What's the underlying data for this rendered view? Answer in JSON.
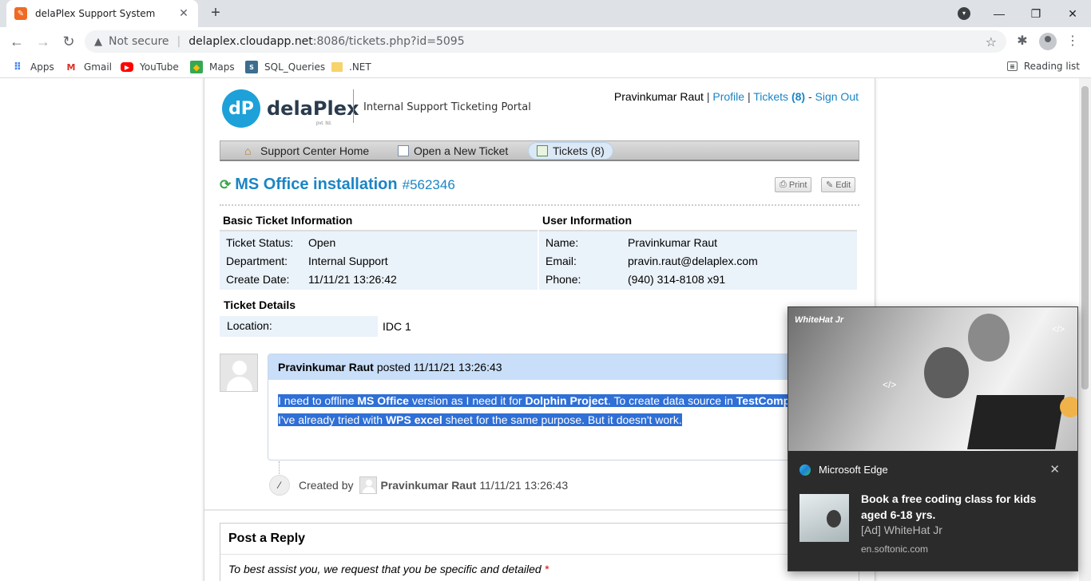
{
  "browser": {
    "tab_title": "delaPlex Support System",
    "tab_close": "✕",
    "new_tab": "+",
    "not_secure": "Not secure",
    "url_host": "delaplex.cloudapp.net",
    "url_rest": ":8086/tickets.php?id=5095",
    "bookmarks": [
      {
        "label": "Apps"
      },
      {
        "label": "Gmail"
      },
      {
        "label": "YouTube"
      },
      {
        "label": "Maps"
      },
      {
        "label": "SQL_Queries"
      },
      {
        "label": ".NET"
      }
    ],
    "reading_list": "Reading list"
  },
  "header": {
    "logo_text": "delaPlex",
    "logo_sub": "pvt. ltd.",
    "portal_title": "Internal Support Ticketing Portal",
    "user_name": "Pravinkumar Raut",
    "profile_link": "Profile",
    "tickets_link": "Tickets",
    "tickets_count": "(8)",
    "signout_link": "Sign Out"
  },
  "nav": {
    "home": "Support Center Home",
    "new_ticket": "Open a New Ticket",
    "tickets": "Tickets (8)"
  },
  "ticket": {
    "title": "MS Office installation",
    "number": "#562346",
    "print_label": "Print",
    "edit_label": "Edit",
    "basic_heading": "Basic Ticket Information",
    "basic_rows": [
      {
        "label": "Ticket Status:",
        "value": "Open"
      },
      {
        "label": "Department:",
        "value": "Internal Support"
      },
      {
        "label": "Create Date:",
        "value": "11/11/21 13:26:42"
      }
    ],
    "user_heading": "User Information",
    "user_rows": [
      {
        "label": "Name:",
        "value": "Pravinkumar Raut"
      },
      {
        "label": "Email:",
        "value": "pravin.raut@delaplex.com"
      },
      {
        "label": "Phone:",
        "value": "(940) 314-8108 x91"
      }
    ],
    "details_heading": "Ticket Details",
    "location_label": "Location:",
    "location_value": "IDC 1"
  },
  "thread": {
    "author": "Pravinkumar Raut",
    "posted_text": "posted 11/11/21 13:26:43",
    "body_1a": "I need to offline ",
    "body_1b": "MS Office",
    "body_1c": " version as I need it for ",
    "body_1d": "Dolphin Project",
    "body_1e": ". To create data source in ",
    "body_1f": "TestComp",
    "body_2a": "I've already tried with ",
    "body_2b": "WPS excel",
    "body_2c": " sheet for the same purpose. But it doesn't work.",
    "event_prefix": "Created by",
    "event_author": "Pravinkumar Raut",
    "event_time": "11/11/21 13:26:43"
  },
  "reply": {
    "title": "Post a Reply",
    "hint": "To best assist you, we request that you be specific and detailed",
    "required_mark": "*"
  },
  "notification": {
    "hero_brand": "WhiteHat Jr",
    "hero_code_glyph": "</>",
    "app_name": "Microsoft Edge",
    "close": "✕",
    "title": "Book a free coding class for kids aged 6-18 yrs.",
    "source": "[Ad] WhiteHat Jr",
    "domain": "en.softonic.com"
  }
}
